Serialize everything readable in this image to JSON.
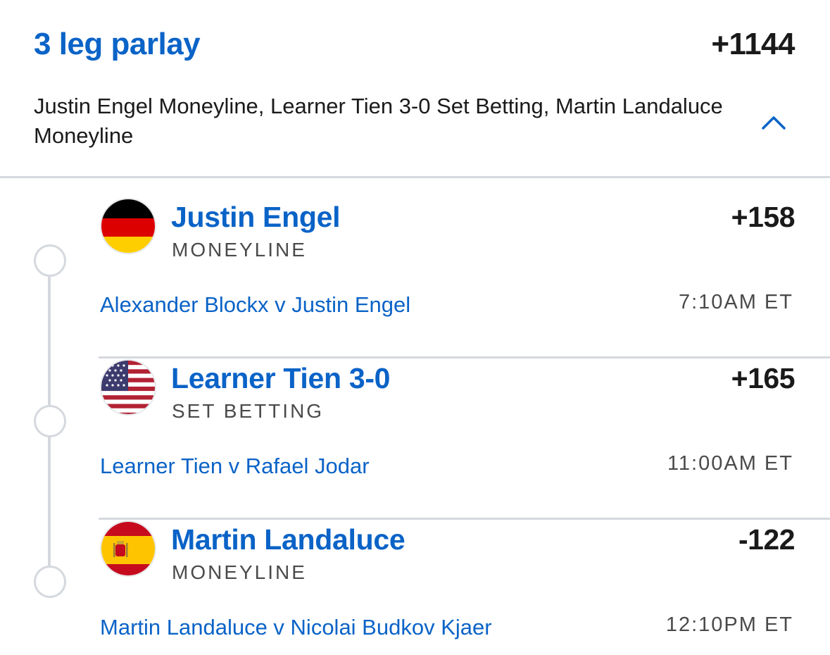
{
  "parlay": {
    "title": "3 leg parlay",
    "odds": "+1144",
    "description": "Justin Engel Moneyline, Learner Tien 3-0 Set Betting, Martin Landaluce Moneyline",
    "collapse_icon": "chevron-up-icon"
  },
  "colors": {
    "accent": "#0a63c7",
    "text": "#1a1a1a",
    "muted": "#4a4a4a",
    "divider": "#d5d9de"
  },
  "legs": [
    {
      "flag": "germany-flag-icon",
      "selection": "Justin Engel",
      "market": "MONEYLINE",
      "odds": "+158",
      "match": "Alexander Blockx v Justin Engel",
      "time": "7:10AM ET"
    },
    {
      "flag": "usa-flag-icon",
      "selection": "Learner Tien 3-0",
      "market": "SET BETTING",
      "odds": "+165",
      "match": "Learner Tien v Rafael Jodar",
      "time": "11:00AM ET"
    },
    {
      "flag": "spain-flag-icon",
      "selection": "Martin Landaluce",
      "market": "MONEYLINE",
      "odds": "-122",
      "match": "Martin Landaluce v Nicolai Budkov Kjaer",
      "time": "12:10PM ET"
    }
  ]
}
